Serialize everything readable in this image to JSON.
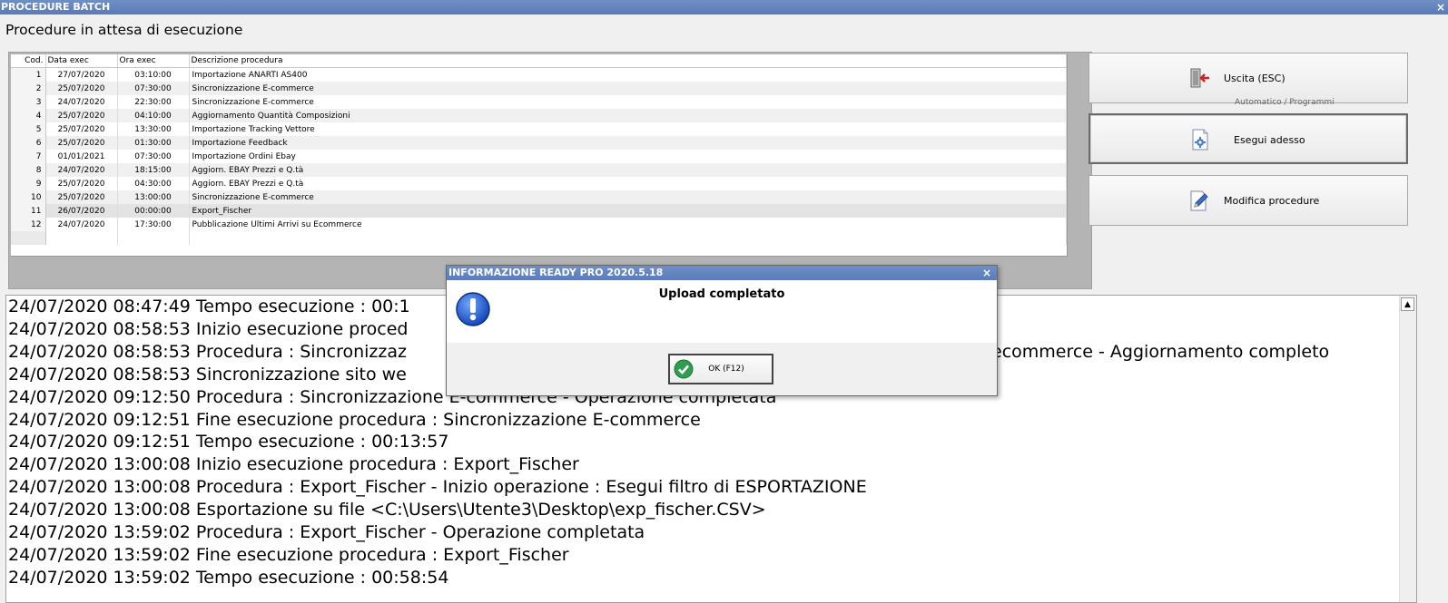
{
  "window": {
    "title": "PROCEDURE BATCH",
    "close_label": "×"
  },
  "heading": "Procedure in attesa di esecuzione",
  "grid": {
    "columns": [
      "Cod.",
      "Data exec",
      "Ora exec",
      "Descrizione procedura"
    ],
    "rows": [
      {
        "cod": "1",
        "date": "27/07/2020",
        "time": "03:10:00",
        "desc": "Importazione ANARTI AS400"
      },
      {
        "cod": "2",
        "date": "25/07/2020",
        "time": "07:30:00",
        "desc": "Sincronizzazione E-commerce"
      },
      {
        "cod": "3",
        "date": "24/07/2020",
        "time": "22:30:00",
        "desc": "Sincronizzazione E-commerce"
      },
      {
        "cod": "4",
        "date": "25/07/2020",
        "time": "04:10:00",
        "desc": "Aggiornamento Quantità Composizioni"
      },
      {
        "cod": "5",
        "date": "25/07/2020",
        "time": "13:30:00",
        "desc": "Importazione Tracking Vettore"
      },
      {
        "cod": "6",
        "date": "25/07/2020",
        "time": "01:30:00",
        "desc": "Importazione Feedback"
      },
      {
        "cod": "7",
        "date": "01/01/2021",
        "time": "07:30:00",
        "desc": "Importazione Ordini Ebay"
      },
      {
        "cod": "8",
        "date": "24/07/2020",
        "time": "18:15:00",
        "desc": "Aggiorn. EBAY Prezzi e Q.tà"
      },
      {
        "cod": "9",
        "date": "25/07/2020",
        "time": "04:30:00",
        "desc": "Aggiorn. EBAY Prezzi e Q.tà"
      },
      {
        "cod": "10",
        "date": "25/07/2020",
        "time": "13:00:00",
        "desc": "Sincronizzazione E-commerce"
      },
      {
        "cod": "11",
        "date": "26/07/2020",
        "time": "00:00:00",
        "desc": "Export_Fischer"
      },
      {
        "cod": "12",
        "date": "24/07/2020",
        "time": "17:30:00",
        "desc": "Pubblicazione Ultimi Arrivi su Ecommerce"
      }
    ]
  },
  "buttons": {
    "exit": "Uscita (ESC)",
    "run_now": "Esegui adesso",
    "edit": "Modifica procedure"
  },
  "ghost_text": "Automatico / Programmi",
  "log": {
    "lines": [
      "24/07/2020 08:47:49 Tempo esecuzione : 00:1",
      "24/07/2020 08:58:53 Inizio esecuzione proced",
      "24/07/2020 08:58:53 Procedura : Sincronizzaz",
      "24/07/2020 08:58:53 Sincronizzazione sito we",
      "24/07/2020 09:12:50 Procedura : Sincronizzazione E-commerce - Operazione completata",
      "24/07/2020 09:12:51 Fine esecuzione procedura : Sincronizzazione E-commerce",
      "24/07/2020 09:12:51 Tempo esecuzione : 00:13:57",
      "24/07/2020 13:00:08 Inizio esecuzione procedura : Export_Fischer",
      "24/07/2020 13:00:08 Procedura : Export_Fischer - Inizio operazione : Esegui filtro di ESPORTAZIONE",
      "24/07/2020 13:00:08 Esportazione su file <C:\\Users\\Utente3\\Desktop\\exp_fischer.CSV>",
      "24/07/2020 13:59:02 Procedura : Export_Fischer - Operazione completata",
      "24/07/2020 13:59:02 Fine esecuzione procedura : Export_Fischer",
      "24/07/2020 13:59:02 Tempo esecuzione : 00:58:54"
    ],
    "overflow_fragment": "ecommerce - Aggiornamento completo",
    "highlight_color": "#fff200"
  },
  "dialog": {
    "title": "INFORMAZIONE READY PRO 2020.5.18",
    "close_label": "×",
    "message": "Upload completato",
    "ok_label": "OK (F12)"
  }
}
